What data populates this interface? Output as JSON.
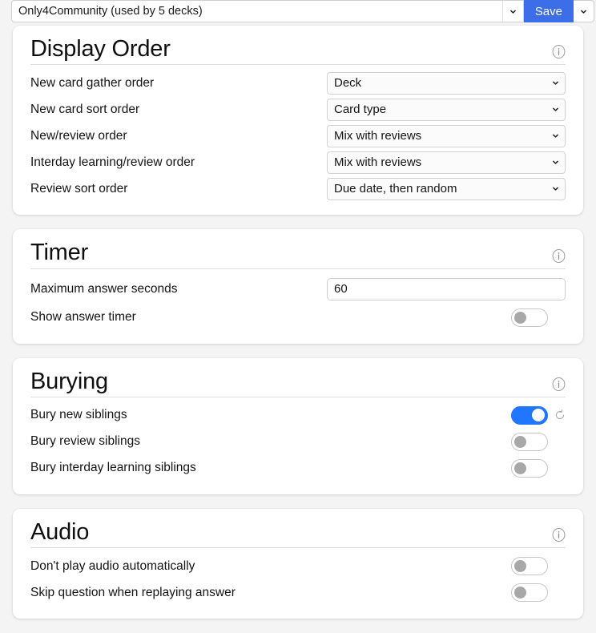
{
  "topbar": {
    "preset_value": "Only4Community (used by 5 decks)",
    "preset_dropdown_icon": "chevron-down-icon",
    "save_label": "Save",
    "save_dropdown_icon": "chevron-down-icon"
  },
  "colors": {
    "accent": "#3b6ee8",
    "toggle_on": "#2176ff",
    "page_bg": "#f4f4f4",
    "card_bg": "#ffffff"
  },
  "sections": [
    {
      "title": "Display Order",
      "info_icon": "info-icon",
      "rows": [
        {
          "label": "New card gather order",
          "type": "select",
          "value": "Deck",
          "icon": "chevron-down-icon"
        },
        {
          "label": "New card sort order",
          "type": "select",
          "value": "Card type",
          "icon": "chevron-down-icon"
        },
        {
          "label": "New/review order",
          "type": "select",
          "value": "Mix with reviews",
          "icon": "chevron-down-icon"
        },
        {
          "label": "Interday learning/review order",
          "type": "select",
          "value": "Mix with reviews",
          "icon": "chevron-down-icon"
        },
        {
          "label": "Review sort order",
          "type": "select",
          "value": "Due date, then random",
          "icon": "chevron-down-icon"
        }
      ]
    },
    {
      "title": "Timer",
      "info_icon": "info-icon",
      "rows": [
        {
          "label": "Maximum answer seconds",
          "type": "text",
          "value": "60"
        },
        {
          "label": "Show answer timer",
          "type": "toggle",
          "on": false,
          "revert": false
        }
      ]
    },
    {
      "title": "Burying",
      "info_icon": "info-icon",
      "rows": [
        {
          "label": "Bury new siblings",
          "type": "toggle",
          "on": true,
          "revert": true,
          "revert_icon": "revert-icon"
        },
        {
          "label": "Bury review siblings",
          "type": "toggle",
          "on": false,
          "revert": false
        },
        {
          "label": "Bury interday learning siblings",
          "type": "toggle",
          "on": false,
          "revert": false
        }
      ]
    },
    {
      "title": "Audio",
      "info_icon": "info-icon",
      "rows": [
        {
          "label": "Don't play audio automatically",
          "type": "toggle",
          "on": false,
          "revert": false
        },
        {
          "label": "Skip question when replaying answer",
          "type": "toggle",
          "on": false,
          "revert": false
        }
      ]
    }
  ]
}
